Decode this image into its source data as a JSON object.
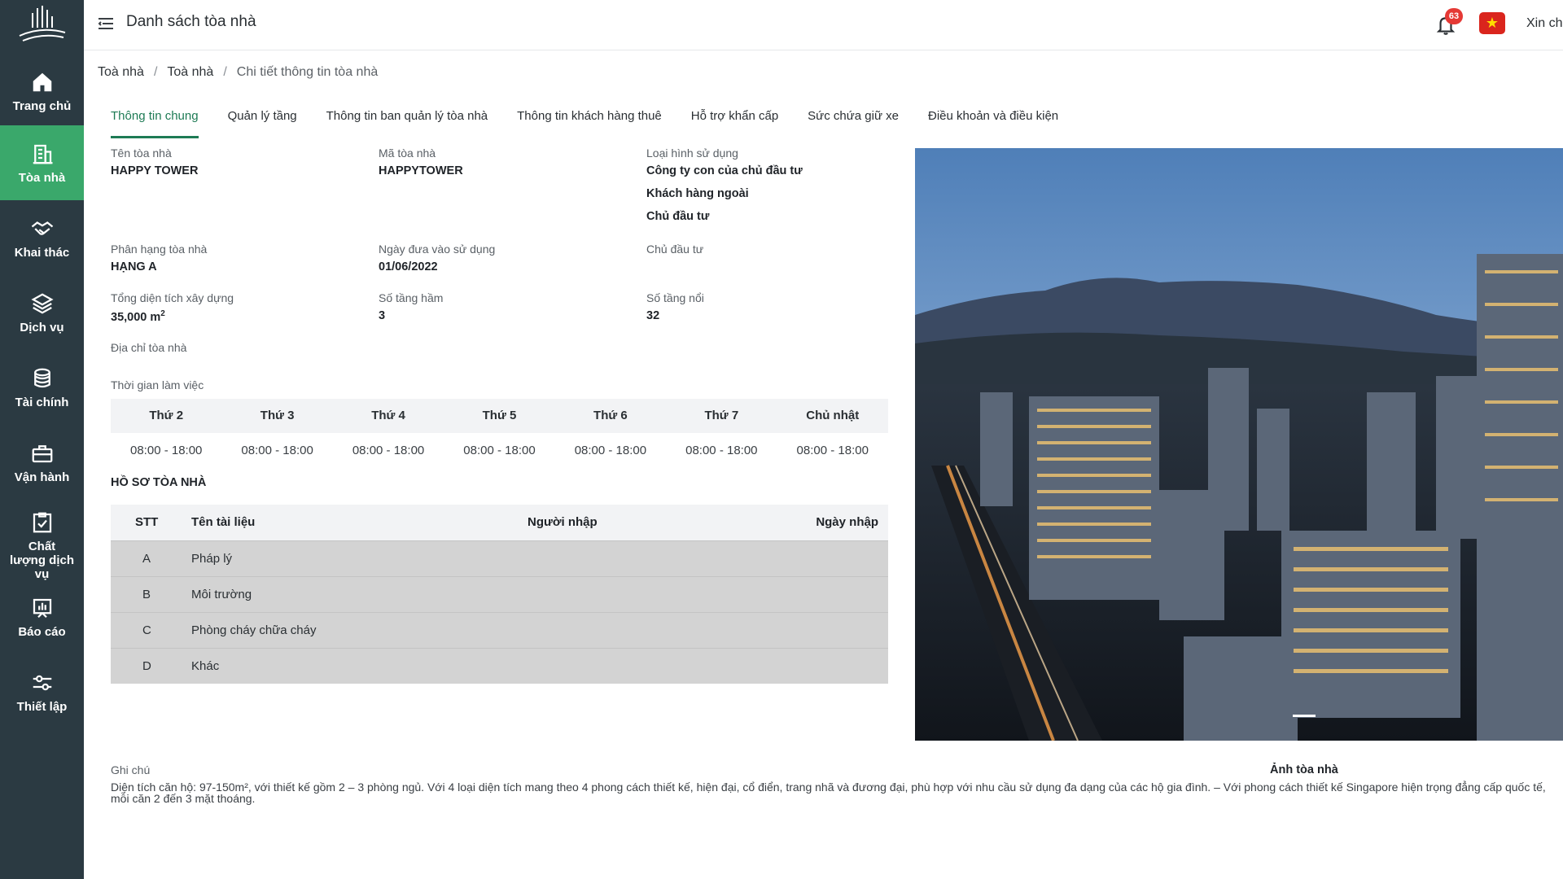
{
  "header": {
    "title": "Danh sách tòa nhà",
    "notifications_count": "63",
    "greeting": "Xin ch"
  },
  "sidebar": {
    "items": [
      {
        "label": "Trang chủ",
        "icon": "home-icon",
        "active": false
      },
      {
        "label": "Tòa nhà",
        "icon": "building-icon",
        "active": true
      },
      {
        "label": "Khai thác",
        "icon": "handshake-icon",
        "active": false
      },
      {
        "label": "Dịch vụ",
        "icon": "layers-icon",
        "active": false
      },
      {
        "label": "Tài chính",
        "icon": "coins-icon",
        "active": false
      },
      {
        "label": "Vận hành",
        "icon": "toolbox-icon",
        "active": false
      },
      {
        "label": "Chất lượng dịch vụ",
        "icon": "checklist-icon",
        "active": false
      },
      {
        "label": "Báo cáo",
        "icon": "chart-icon",
        "active": false
      },
      {
        "label": "Thiết lập",
        "icon": "sliders-icon",
        "active": false
      }
    ]
  },
  "breadcrumb": [
    "Toà nhà",
    "Toà nhà",
    "Chi tiết thông tin tòa nhà"
  ],
  "tabs": [
    "Thông tin chung",
    "Quản lý tầng",
    "Thông tin ban quản lý tòa nhà",
    "Thông tin khách hàng thuê",
    "Hỗ trợ khẩn cấp",
    "Sức chứa giữ xe",
    "Điều khoản và điều kiện"
  ],
  "info": {
    "name_label": "Tên tòa nhà",
    "name_value": "HAPPY TOWER",
    "code_label": "Mã tòa nhà",
    "code_value": "HAPPYTOWER",
    "usage_label": "Loại hình sử dụng",
    "usage_values": [
      "Công ty con của chủ đầu tư",
      "Khách hàng ngoài",
      "Chủ đầu tư"
    ],
    "class_label": "Phân hạng tòa nhà",
    "class_value": "HẠNG A",
    "date_label": "Ngày đưa vào sử dụng",
    "date_value": "01/06/2022",
    "investor_label": "Chủ đầu tư",
    "area_label": "Tổng diện tích xây dựng",
    "area_value": "35,000 m",
    "area_unit_sup": "2",
    "basement_label": "Số tầng hầm",
    "basement_value": "3",
    "floors_label": "Số tầng nổi",
    "floors_value": "32",
    "address_label": "Địa chỉ tòa nhà"
  },
  "working_hours": {
    "label": "Thời gian làm việc",
    "days": [
      "Thứ 2",
      "Thứ 3",
      "Thứ 4",
      "Thứ 5",
      "Thứ 6",
      "Thứ 7",
      "Chủ nhật"
    ],
    "hours": [
      "08:00 - 18:00",
      "08:00 - 18:00",
      "08:00 - 18:00",
      "08:00 - 18:00",
      "08:00 - 18:00",
      "08:00 - 18:00",
      "08:00 - 18:00"
    ]
  },
  "documents": {
    "title": "HỒ SƠ TÒA NHÀ",
    "columns": [
      "STT",
      "Tên tài liệu",
      "Người nhập",
      "Ngày nhập"
    ],
    "rows": [
      {
        "stt": "A",
        "name": "Pháp lý"
      },
      {
        "stt": "B",
        "name": "Môi trường"
      },
      {
        "stt": "C",
        "name": "Phòng cháy chữa cháy"
      },
      {
        "stt": "D",
        "name": "Khác"
      }
    ]
  },
  "photo": {
    "caption": "Ảnh tòa nhà"
  },
  "notes": {
    "label": "Ghi chú",
    "text": "Diện tích căn hộ: 97-150m², với thiết kế gồm 2 – 3 phòng ngủ. Với 4 loại diện tích mang theo 4 phong cách thiết kế, hiện đại, cổ điển, trang nhã và đương đại, phù hợp với nhu cầu sử dụng đa dạng của các hộ gia đình. – Với phong cách thiết kế Singapore hiện trọng đẳng cấp quốc tế, mỗi căn 2 đến 3 mặt thoáng."
  },
  "colors": {
    "sidebar_bg": "#2b3a42",
    "active_green": "#3aa86b",
    "tab_active": "#1e7b55",
    "badge_red": "#e53935"
  }
}
